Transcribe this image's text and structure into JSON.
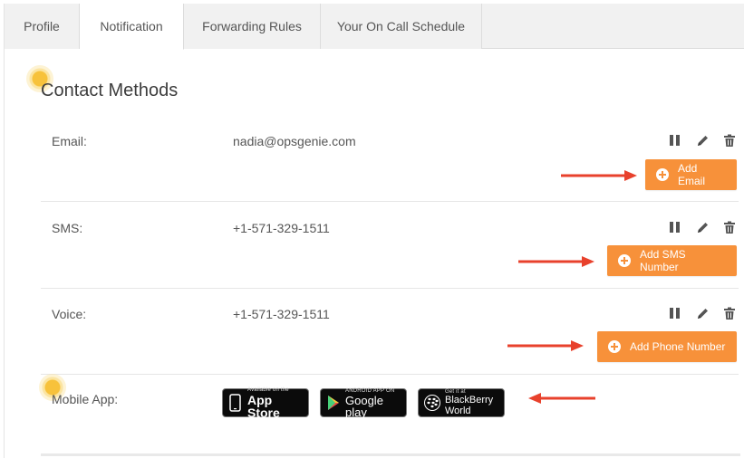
{
  "tabs": [
    {
      "label": "Profile",
      "active": false
    },
    {
      "label": "Notification",
      "active": true
    },
    {
      "label": "Forwarding Rules",
      "active": false
    },
    {
      "label": "Your On Call Schedule",
      "active": false
    }
  ],
  "section_title": "Contact Methods",
  "methods": [
    {
      "label": "Email:",
      "value": "nadia@opsgenie.com",
      "button": "Add Email"
    },
    {
      "label": "SMS:",
      "value": "+1-571-329-1511",
      "button": "Add SMS Number"
    },
    {
      "label": "Voice:",
      "value": "+1-571-329-1511",
      "button": "Add Phone Number"
    }
  ],
  "mobile": {
    "label": "Mobile App:",
    "badges": [
      {
        "small": "Available on the",
        "big": "App Store",
        "icon": "apple-icon"
      },
      {
        "small": "ANDROID APP ON",
        "big": "Google play",
        "icon": "google-play-icon"
      },
      {
        "small": "Get it at",
        "big": "BlackBerry",
        "big2": "World",
        "icon": "blackberry-icon"
      }
    ]
  },
  "icons": {
    "pause": "pause-icon",
    "edit": "pencil-icon",
    "delete": "trash-icon",
    "add": "plus-circle-icon",
    "annotation": "red-arrow"
  },
  "colors": {
    "accent": "#f7913a",
    "arrow": "#e8412c",
    "highlight": "#f7c23b"
  }
}
